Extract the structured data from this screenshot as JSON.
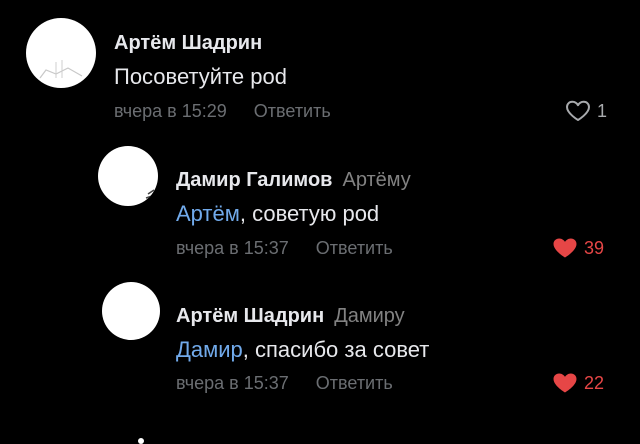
{
  "colors": {
    "background": "#000000",
    "text": "#e7e8ec",
    "meta": "#6b6e72",
    "mention": "#71aaeb",
    "liked_heart": "#e64646",
    "unliked_heart": "#a8aaad"
  },
  "comments": [
    {
      "author": "Артём Шадрин",
      "reply_to": "",
      "mention": "",
      "text": "Посоветуйте pod",
      "time": "вчера в 15:29",
      "reply_label": "Ответить",
      "likes": "1",
      "liked": false,
      "like_icon": "heart-outline-icon"
    },
    {
      "author": "Дамир Галимов",
      "reply_to": "Артёму",
      "mention": "Артём",
      "text": ", советую pod",
      "time": "вчера в 15:37",
      "reply_label": "Ответить",
      "likes": "39",
      "liked": true,
      "like_icon": "heart-filled-icon"
    },
    {
      "author": "Артём Шадрин",
      "reply_to": "Дамиру",
      "mention": "Дамир",
      "text": ", спасибо за совет",
      "time": "вчера в 15:37",
      "reply_label": "Ответить",
      "likes": "22",
      "liked": true,
      "like_icon": "heart-filled-icon"
    }
  ]
}
